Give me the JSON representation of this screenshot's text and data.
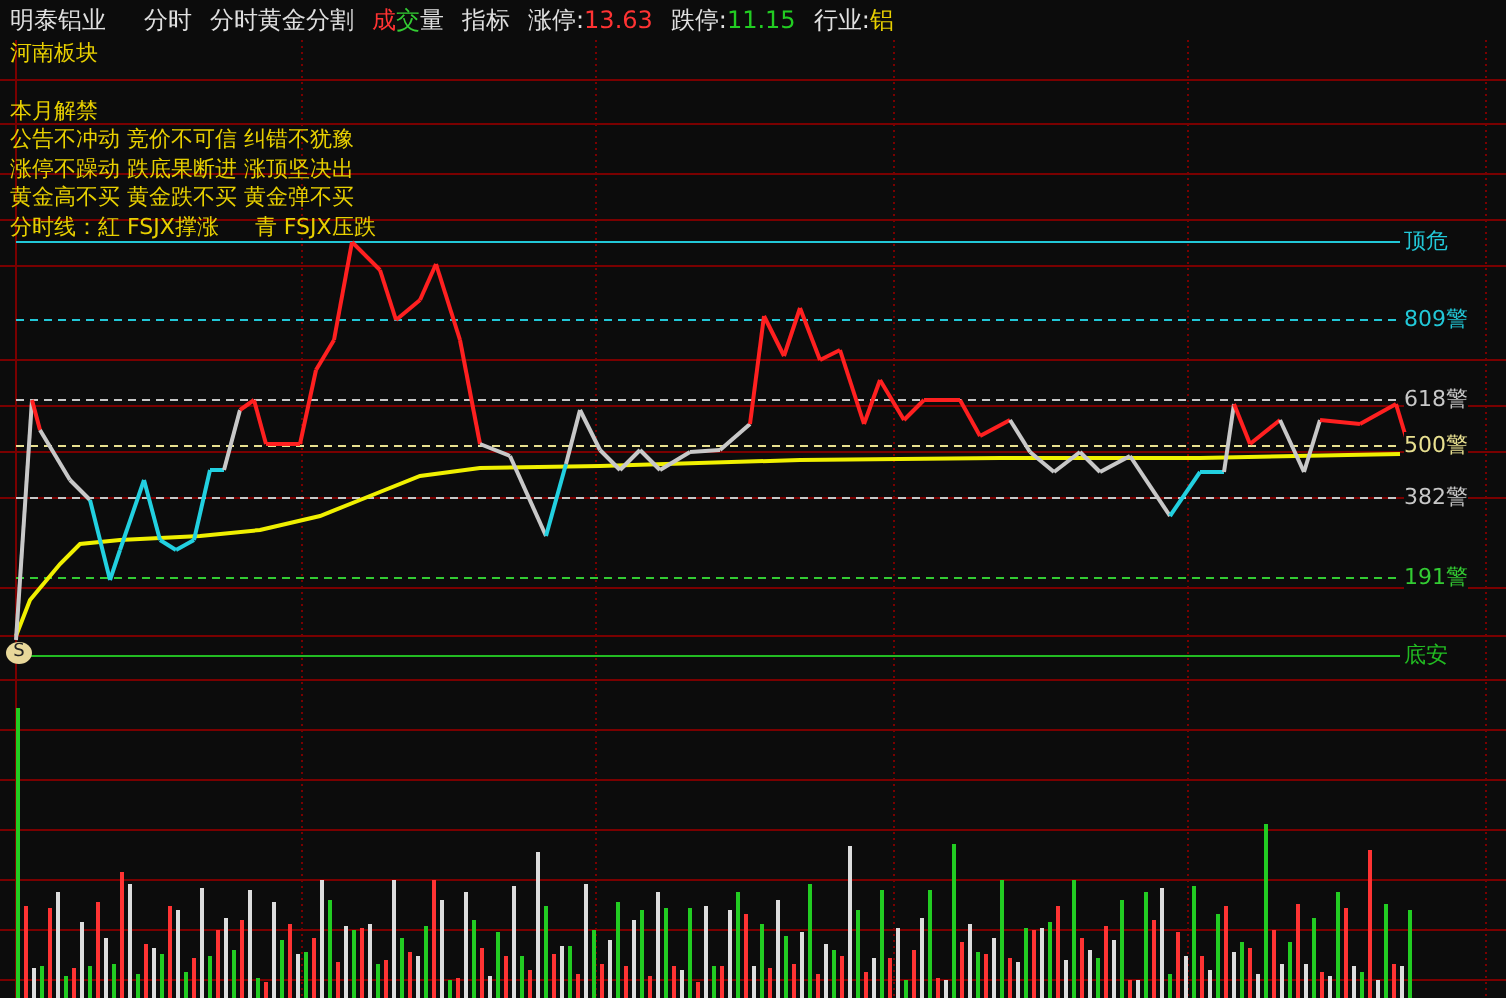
{
  "header": {
    "stock_name": "明泰铝业",
    "menu": [
      {
        "parts": [
          {
            "text": "分时",
            "color": "#e0e0e0"
          }
        ]
      },
      {
        "parts": [
          {
            "text": "分时黄金分割",
            "color": "#e0e0e0"
          }
        ]
      },
      {
        "parts": [
          {
            "text": "成",
            "color": "#ff3333"
          },
          {
            "text": "交",
            "color": "#33cc33"
          },
          {
            "text": "量",
            "color": "#e0e0e0"
          }
        ]
      },
      {
        "parts": [
          {
            "text": "指标",
            "color": "#e0e0e0"
          }
        ]
      }
    ],
    "quotes": [
      {
        "label": "涨停:",
        "value": "13.63",
        "color": "#ff3333"
      },
      {
        "label": "跌停:",
        "value": "11.15",
        "color": "#22cc22"
      },
      {
        "label": "行业:",
        "value": "铝",
        "color": "#e8d000"
      }
    ]
  },
  "notes": {
    "sector": "河南板块",
    "lines": [
      "本月解禁",
      "公告不冲动 竞价不可信 纠错不犹豫",
      "涨停不躁动 跌底果断进 涨顶坚决出",
      "黄金高不买 黄金跌不买 黄金弹不买"
    ],
    "legend": [
      "分时线：紅 FSJX撑涨",
      "青 FSJX压跌"
    ]
  },
  "levels": [
    {
      "label": "顶危",
      "color": "#22c8d8",
      "kind": "solid"
    },
    {
      "label": "809警",
      "color": "#22c8d8",
      "kind": "dashed"
    },
    {
      "label": "618警",
      "color": "#c8c8c8",
      "kind": "dashed"
    },
    {
      "label": "500警",
      "color": "#e8e090",
      "kind": "dashed"
    },
    {
      "label": "382警",
      "color": "#c8c8c8",
      "kind": "dashed"
    },
    {
      "label": "191警",
      "color": "#33cc33",
      "kind": "dashed"
    },
    {
      "label": "底安",
      "color": "#22bb22",
      "kind": "solid"
    }
  ],
  "marker": "S"
}
